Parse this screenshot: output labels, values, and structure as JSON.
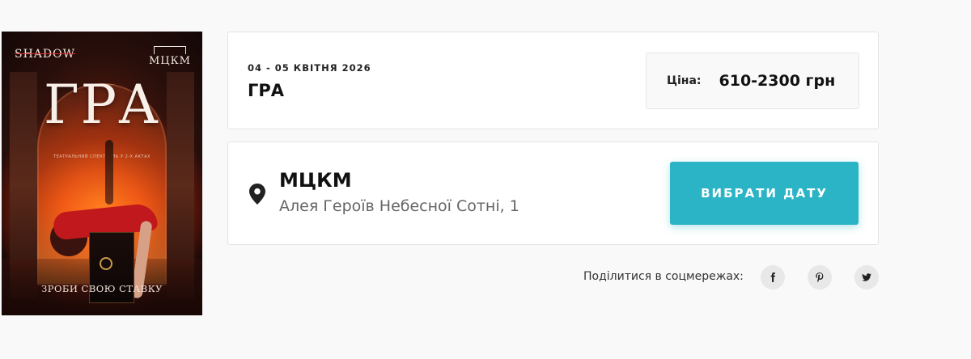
{
  "poster": {
    "brand_left": "SHADOW",
    "brand_right": "МЦКМ",
    "title": "ГРА",
    "subtitle": "ТЕАТРАЛЬНИЙ СПЕКТАКЛЬ У 2-Х АКТАХ",
    "tagline": "ЗРОБИ СВОЮ СТАВКУ"
  },
  "event": {
    "date": "04 - 05 КВІТНЯ 2026",
    "name": "ГРА",
    "price_label": "Ціна:",
    "price_value": "610-2300 грн"
  },
  "venue": {
    "icon": "map-pin-icon",
    "name": "МЦКМ",
    "address": "Алея Героїв Небесної Сотні, 1",
    "button_label": "ВИБРАТИ ДАТУ",
    "button_color": "#2bb4c6"
  },
  "share": {
    "label": "Поділитися в соцмережах:",
    "networks": [
      "facebook-icon",
      "pinterest-icon",
      "twitter-icon"
    ]
  }
}
